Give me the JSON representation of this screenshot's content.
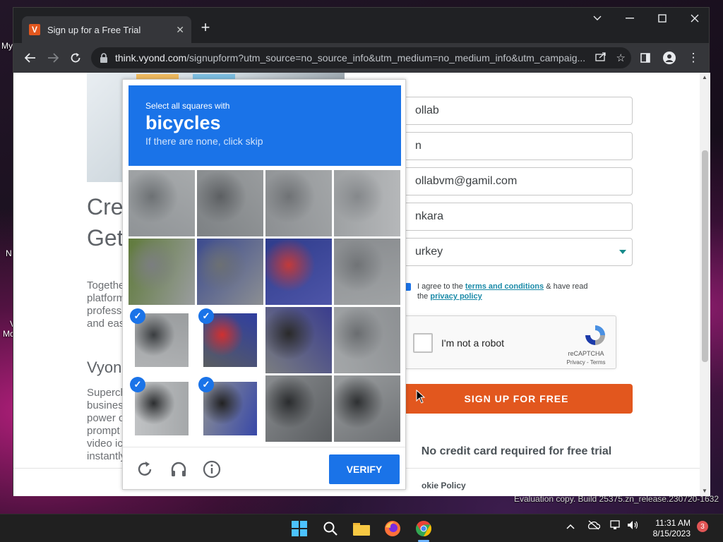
{
  "desktop": {
    "labels": [
      "My",
      "N",
      "V",
      "Mc"
    ],
    "eval_text": "Evaluation copy. Build 25375.zn_release.230720-1632"
  },
  "browser": {
    "tab": {
      "favicon_letter": "V",
      "title": "Sign up for a Free Trial"
    },
    "address": {
      "host": "think.vyond.com",
      "path": "/signupform?utm_source=no_source_info&utm_medium=no_medium_info&utm_campaig..."
    }
  },
  "page": {
    "headline_1": "Cre",
    "headline_2": "Get",
    "para1": [
      "Togethe",
      "platform",
      "professi",
      "and eas"
    ],
    "subhead": "Vyon",
    "para2": [
      "Superch",
      "busines",
      "power c",
      "prompt",
      "video ic",
      "instantly"
    ],
    "form": {
      "first_name": "ollab",
      "last_name": "n",
      "email": "ollabvm@gamil.com",
      "city": "nkara",
      "country": "urkey",
      "agree_prefix": "I agree to the ",
      "terms_link": "terms and conditions",
      "agree_mid": " & have read",
      "agree_the": "the ",
      "privacy_link": "privacy policy",
      "signup_label": "SIGN UP FOR FREE",
      "no_credit": "No credit card required for free trial",
      "cookie": "okie Policy"
    },
    "recaptcha": {
      "label": "I'm not a robot",
      "brand": "reCAPTCHA",
      "links": "Privacy - Terms"
    }
  },
  "captcha": {
    "instruction": "Select all squares with",
    "target": "bicycles",
    "hint": "If there are none, click skip",
    "verify_label": "VERIFY",
    "selected_tiles": [
      8,
      9,
      12,
      13
    ],
    "check_glyph": "✓"
  },
  "taskbar": {
    "time": "11:31 AM",
    "date": "8/15/2023",
    "notifications": "3"
  },
  "colors": {
    "accent": "#1a73e8",
    "brand": "#e2571e"
  }
}
